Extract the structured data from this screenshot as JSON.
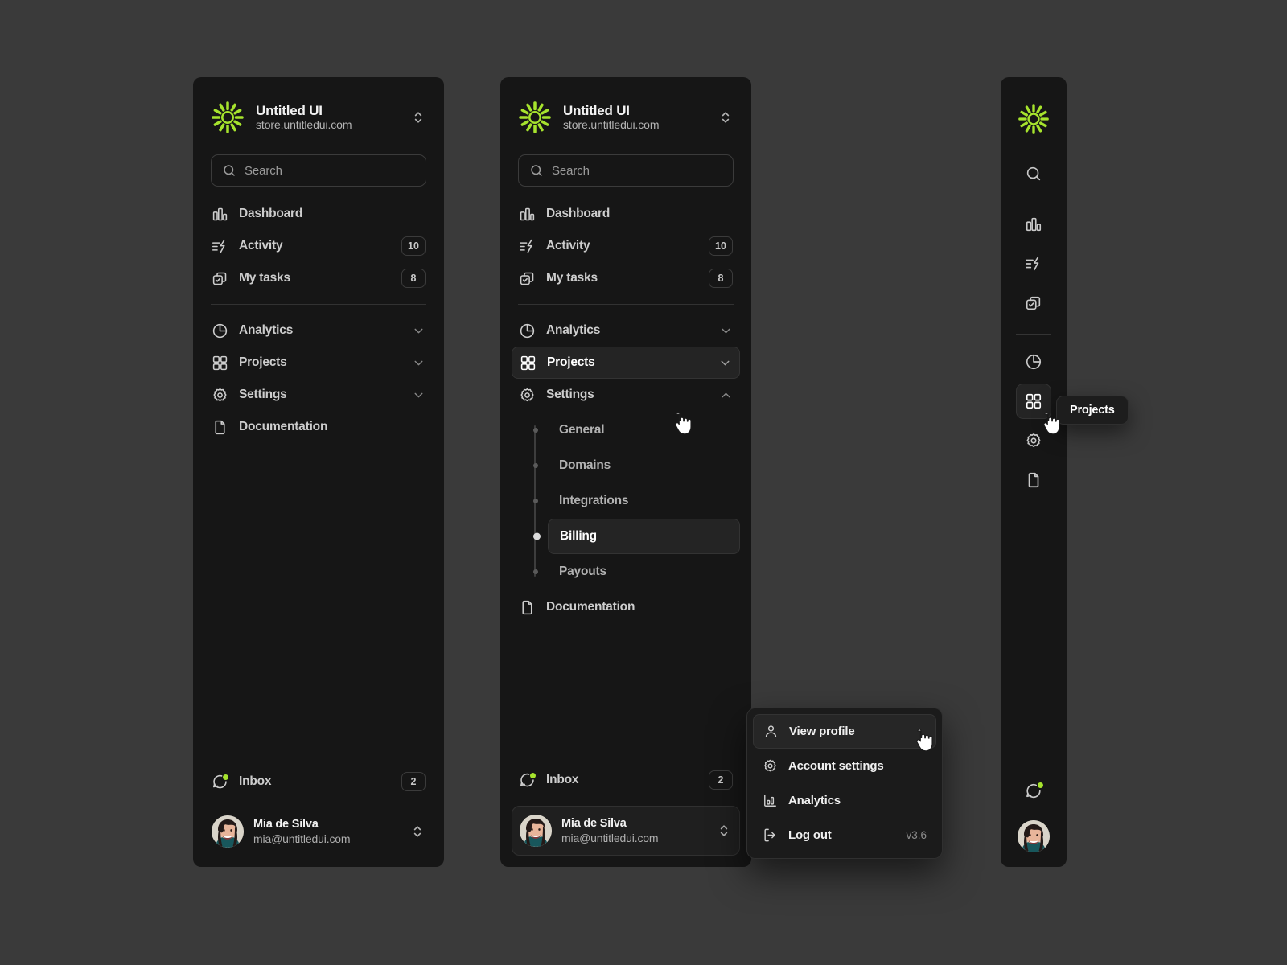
{
  "colors": {
    "page_background": "#3a3a3a",
    "panel_background": "#161616",
    "accent_green": "#a6e32d",
    "active_row": "#242424",
    "text_primary": "#ffffff",
    "text_secondary": "#b2b2b2"
  },
  "brand": {
    "name": "Untitled UI",
    "url": "store.untitledui.com",
    "logo_icon": "sunburst-logo-icon",
    "switcher_icon": "chevron-up-down-icon"
  },
  "search": {
    "placeholder": "Search",
    "value": "",
    "icon": "search-icon"
  },
  "nav": {
    "primary": [
      {
        "label": "Dashboard",
        "icon": "bar-chart-icon",
        "badge": null
      },
      {
        "label": "Activity",
        "icon": "activity-lightning-icon",
        "badge": "10"
      },
      {
        "label": "My tasks",
        "icon": "checked-copy-icon",
        "badge": "8"
      }
    ],
    "secondary": [
      {
        "label": "Analytics",
        "icon": "pie-chart-icon",
        "expandable": true,
        "expanded": false
      },
      {
        "label": "Projects",
        "icon": "grid-squares-icon",
        "expandable": true,
        "expanded": false
      },
      {
        "label": "Settings",
        "icon": "gear-icon",
        "expandable": true,
        "expanded": false
      },
      {
        "label": "Documentation",
        "icon": "file-document-icon",
        "expandable": false
      }
    ],
    "settings_children": [
      {
        "label": "General",
        "selected": false
      },
      {
        "label": "Domains",
        "selected": false
      },
      {
        "label": "Integrations",
        "selected": false
      },
      {
        "label": "Billing",
        "selected": true
      },
      {
        "label": "Payouts",
        "selected": false
      }
    ],
    "inbox": {
      "label": "Inbox",
      "icon": "chat-bubble-icon",
      "badge": "2",
      "has_unread_dot": true
    }
  },
  "account": {
    "name": "Mia de Silva",
    "email": "mia@untitledui.com",
    "switcher_icon": "chevron-up-down-icon",
    "avatar_icon": "user-avatar"
  },
  "panels": {
    "left": {
      "variant": "collapsed-groups"
    },
    "middle": {
      "variant": "expanded-settings",
      "hovered_item": "Projects",
      "expanded_item": "Settings"
    },
    "right": {
      "variant": "icon-rail",
      "active_item": "Projects"
    }
  },
  "tooltip": {
    "text": "Projects"
  },
  "dropdown": {
    "items": [
      {
        "label": "View profile",
        "icon": "user-icon",
        "hovered": true,
        "meta": null
      },
      {
        "label": "Account settings",
        "icon": "gear-icon",
        "hovered": false,
        "meta": null
      },
      {
        "label": "Analytics",
        "icon": "bar-chart-icon",
        "hovered": false,
        "meta": null
      },
      {
        "label": "Log out",
        "icon": "logout-arrow-icon",
        "hovered": false,
        "meta": "v3.6"
      }
    ]
  },
  "rail": {
    "top_icons": [
      "search-icon",
      "bar-chart-icon",
      "activity-lightning-icon",
      "checked-copy-icon"
    ],
    "group_icons": [
      "pie-chart-icon",
      "grid-squares-icon",
      "gear-icon",
      "file-document-icon"
    ]
  }
}
